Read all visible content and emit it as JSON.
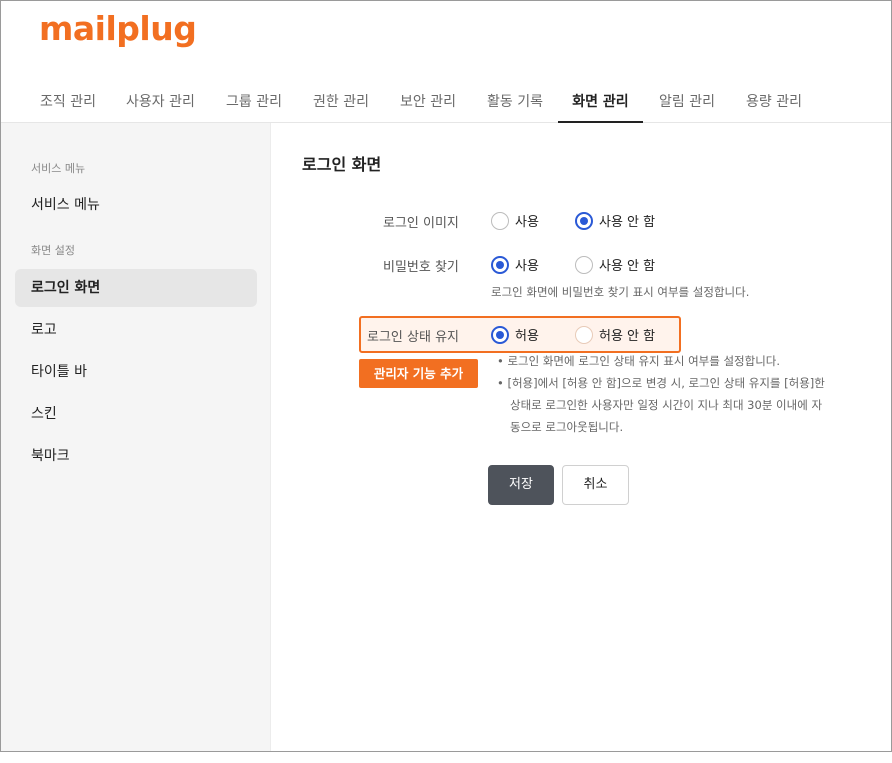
{
  "logo": "mailplug",
  "tabs": [
    {
      "label": "조직 관리"
    },
    {
      "label": "사용자 관리"
    },
    {
      "label": "그룹 관리"
    },
    {
      "label": "권한 관리"
    },
    {
      "label": "보안 관리"
    },
    {
      "label": "활동 기록"
    },
    {
      "label": "화면 관리"
    },
    {
      "label": "알림 관리"
    },
    {
      "label": "용량 관리"
    }
  ],
  "active_tab": "화면 관리",
  "sidebar": {
    "section1": "서비스 메뉴",
    "item_service_menu": "서비스 메뉴",
    "section2": "화면 설정",
    "items": [
      {
        "label": "로그인 화면"
      },
      {
        "label": "로고"
      },
      {
        "label": "타이틀 바"
      },
      {
        "label": "스킨"
      },
      {
        "label": "북마크"
      }
    ],
    "active_item": "로그인 화면"
  },
  "main": {
    "title": "로그인 화면",
    "login_image": {
      "label": "로그인 이미지",
      "opt1": "사용",
      "opt2": "사용 안 함",
      "selected": "사용 안 함"
    },
    "password_find": {
      "label": "비밀번호 찾기",
      "opt1": "사용",
      "opt2": "사용 안 함",
      "selected": "사용",
      "help": "로그인 화면에 비밀번호 찾기 표시 여부를 설정합니다."
    },
    "keep_login": {
      "label": "로그인 상태 유지",
      "opt1": "허용",
      "opt2": "허용 안 함",
      "selected": "허용",
      "help1": "로그인 화면에 로그인 상태 유지 표시 여부를 설정합니다.",
      "help2_line1": "[허용]에서 [허용 안 함]으로 변경 시, 로그인 상태 유지를 [허용]한",
      "help2_line2": "상태로 로그인한 사용자만 일정 시간이 지나 최대 30분 이내에 자",
      "help2_line3": "동으로 로그아웃됩니다."
    },
    "badge": "관리자 기능 추가",
    "save_button": "저장",
    "cancel_button": "취소"
  },
  "colors": {
    "brand": "#f26f21",
    "radio_selected": "#2a59d6",
    "primary_button": "#4e535b"
  }
}
